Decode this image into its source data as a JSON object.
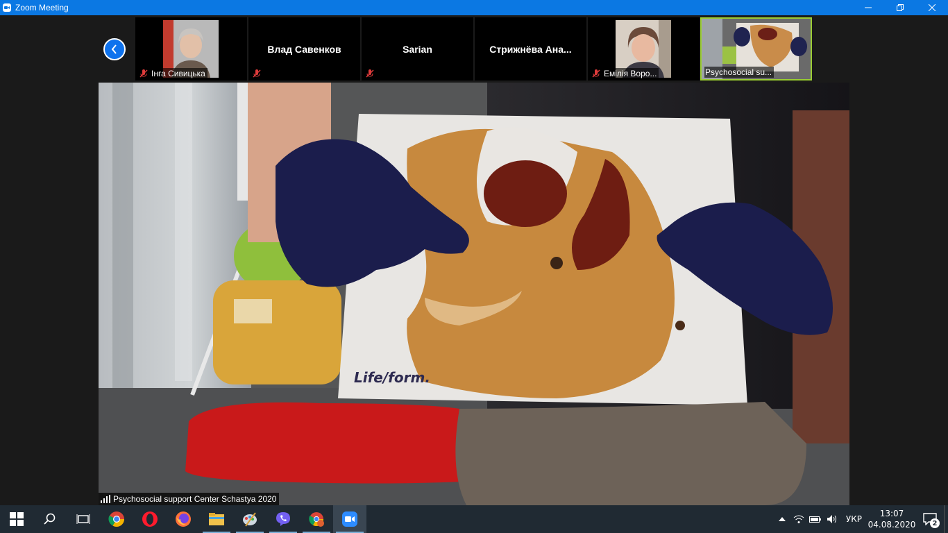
{
  "window": {
    "title": "Zoom Meeting"
  },
  "participants": [
    {
      "name": "Інга Сивицька",
      "has_video": true,
      "muted": true
    },
    {
      "name": "Влад Савенков",
      "has_video": false,
      "muted": true
    },
    {
      "name": "Sarian",
      "has_video": false,
      "muted": true
    },
    {
      "name": "Стрижнёва  Ана...",
      "has_video": false,
      "muted": false
    },
    {
      "name": "Емілія Воро...",
      "has_video": true,
      "muted": true
    },
    {
      "name": "Psychosocial su...",
      "has_video": true,
      "muted": false,
      "active": true
    }
  ],
  "main_video": {
    "label": "Psychosocial support Center Schastya 2020",
    "board_text": "Life/form."
  },
  "taskbar": {
    "apps": [
      "start-icon",
      "search-icon",
      "task-view-icon",
      "chrome-icon",
      "opera-icon",
      "firefox-icon",
      "file-explorer-icon",
      "paint-icon",
      "viber-icon",
      "chrome-profile-icon",
      "zoom-icon"
    ],
    "language": "УКР",
    "time": "13:07",
    "date": "04.08.2020",
    "notifications": "2"
  },
  "colors": {
    "titlebar": "#0b78e3",
    "accent": "#0e72ed",
    "active_border": "#9acd32",
    "taskbar": "#202a33"
  }
}
